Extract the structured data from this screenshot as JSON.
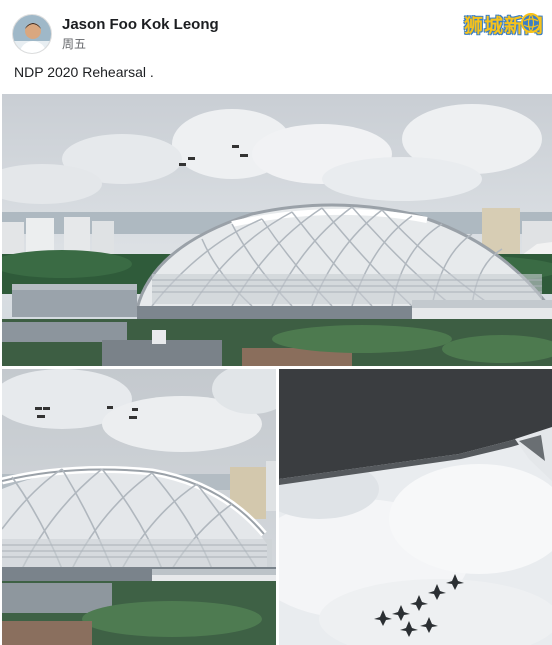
{
  "post": {
    "author_name": "Jason Foo Kok Leong",
    "timestamp": "周五",
    "caption": "NDP 2020 Rehearsal .",
    "watermark": "狮城新闻"
  },
  "photos": [
    {
      "name": "stadium-flypast-photo"
    },
    {
      "name": "stadium-closeup-photo"
    },
    {
      "name": "jets-formation-photo"
    }
  ],
  "colors": {
    "watermark_yellow": "#f7c21a",
    "watermark_outline": "#3b7ec4",
    "secondary_text": "#65676b"
  }
}
